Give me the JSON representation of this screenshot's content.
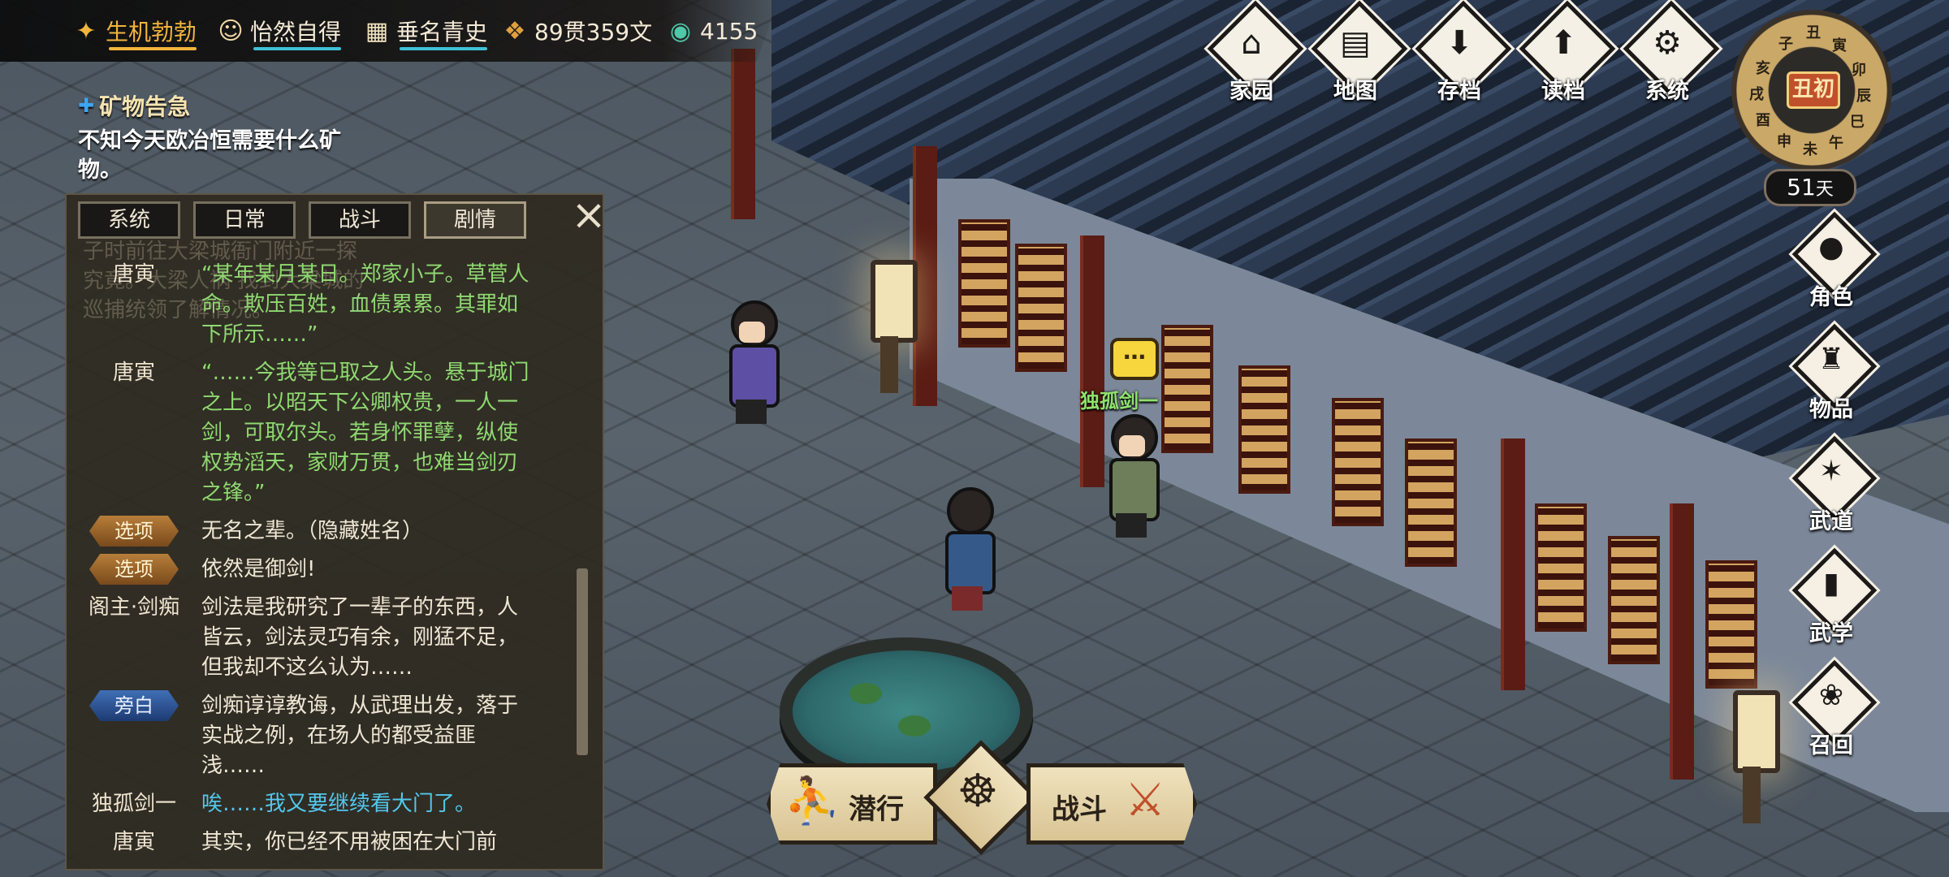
{
  "topbar": {
    "stats": [
      {
        "icon": "strength-icon",
        "label": "生机勃勃",
        "color": "#f2b43c"
      },
      {
        "icon": "mood-face-icon",
        "label": "怡然自得",
        "color": "#3fc1d6"
      },
      {
        "icon": "fame-scroll-icon",
        "label": "垂名青史",
        "color": "#3fc1d6"
      },
      {
        "icon": "copper-coin-icon",
        "label": "89贯359文"
      },
      {
        "icon": "jade-icon",
        "label": "4155"
      }
    ]
  },
  "menu": {
    "home": "家园",
    "map": "地图",
    "save": "存档",
    "load": "读档",
    "system": "系统"
  },
  "clock": {
    "time_label": "丑初",
    "ticks": [
      "丑",
      "寅",
      "卯",
      "辰",
      "巳",
      "午",
      "未",
      "申",
      "酉",
      "戌",
      "亥",
      "子"
    ],
    "days_value": "51",
    "days_unit": "天"
  },
  "side_menu": {
    "character": "角色",
    "items": "物品",
    "martial": "武道",
    "study": "武学",
    "summon": "召回"
  },
  "quest": {
    "title": "矿物告急",
    "description": "不知今天欧冶恒需要什么矿物。"
  },
  "log": {
    "tabs": [
      "系统",
      "日常",
      "战斗",
      "剧情"
    ],
    "active_tab": "剧情",
    "close": "×",
    "ghost_text": "子时前往大梁城衙门附近一探究竟。大梁人祸 找到大梁城的巡捕统领了解情况。",
    "entries": [
      {
        "speaker": "唐寅",
        "type": "narrate",
        "text": "“某年某月某日。郑家小子。草菅人命。欺压百姓，血债累累。其罪如下所示……”"
      },
      {
        "speaker": "唐寅",
        "type": "narrate",
        "text": "“……今我等已取之人头。悬于城门之上。以昭天下公卿权贵，一人一剑，可取尔头。若身怀罪孽，纵使权势滔天，家财万贯，也难当剑刃之锋。”"
      },
      {
        "badge": "选项",
        "badge_type": "option",
        "text": "无名之辈。（隐藏姓名）"
      },
      {
        "badge": "选项",
        "badge_type": "option",
        "text": "依然是御剑!"
      },
      {
        "speaker": "阁主·剑痴",
        "type": "normal",
        "text": "剑法是我研究了一辈子的东西，人皆云，剑法灵巧有余，刚猛不足，但我却不这么认为……"
      },
      {
        "badge": "旁白",
        "badge_type": "narr",
        "text": "剑痴谆谆教诲，从武理出发，落于实战之例，在场人的都受益匪浅……"
      },
      {
        "speaker": "独孤剑一",
        "type": "dugu",
        "text": "唉……我又要继续看大门了。"
      },
      {
        "speaker": "唐寅",
        "type": "normal",
        "text": "其实，你已经不用被困在大门前"
      }
    ]
  },
  "scene": {
    "npc_name": "独孤剑一",
    "speech_icon": "…"
  },
  "actions": {
    "sneak": "潜行",
    "fight": "战斗"
  },
  "colors": {
    "npc_name": "#8fe26d",
    "narrate_text": "#8fd970",
    "dugu_text": "#52c7ec",
    "option_badge": "#b77e3a",
    "narr_badge": "#3f6fb6"
  }
}
